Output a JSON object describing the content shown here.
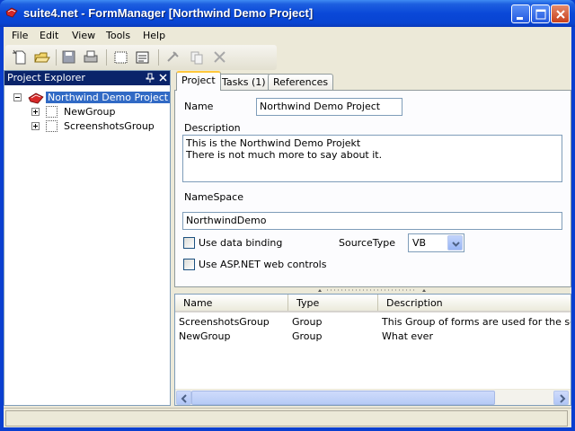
{
  "window": {
    "title": "suite4.net - FormManager [Northwind Demo Project]"
  },
  "menu": [
    "File",
    "Edit",
    "View",
    "Tools",
    "Help"
  ],
  "explorer": {
    "title": "Project Explorer",
    "tree": {
      "root": "Northwind Demo Project",
      "children": [
        "NewGroup",
        "ScreenshotsGroup"
      ]
    }
  },
  "tabs": [
    "Project",
    "Tasks (1)",
    "References"
  ],
  "form": {
    "name_label": "Name",
    "name_value": "Northwind Demo Project",
    "description_label": "Description",
    "description_lines": [
      "This is the Northwind Demo Projekt",
      "There is not much more to say about it."
    ],
    "namespace_label": "NameSpace",
    "namespace_value": "NorthwindDemo",
    "use_data_binding_label": "Use data binding",
    "source_type_label": "SourceType",
    "source_type_value": "VB",
    "use_aspnet_label": "Use ASP.NET web controls"
  },
  "list": {
    "columns": [
      "Name",
      "Type",
      "Description"
    ],
    "rows": [
      [
        "ScreenshotsGroup",
        "Group",
        "This Group of forms are used for the screenshots"
      ],
      [
        "NewGroup",
        "Group",
        "What ever"
      ]
    ]
  },
  "colors": {
    "titlebar": "#0a48d8",
    "selection": "#316ac5",
    "explorer_header": "#0a246a",
    "active_tab_accent": "#ffc83c"
  }
}
